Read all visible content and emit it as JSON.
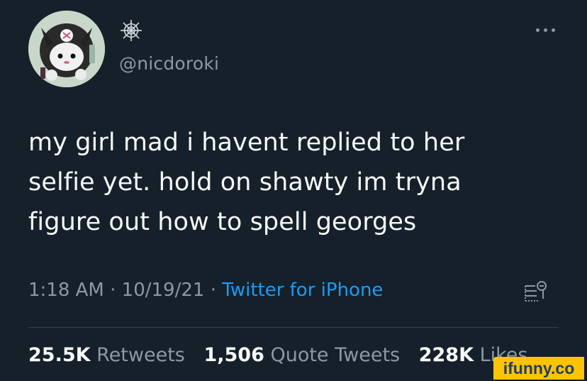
{
  "tweet": {
    "handle": "@nicdoroki",
    "text": "my girl mad i havent replied to her selfie yet. hold on shawty im tryna figure out how to spell georges",
    "time": "1:18 AM",
    "date": "10/19/21",
    "separator": "·",
    "source": "Twitter for iPhone",
    "stats": {
      "retweets_count": "25.5K",
      "retweets_label": "Retweets",
      "quotes_count": "1,506",
      "quotes_label": "Quote Tweets",
      "likes_count": "228K",
      "likes_label": "Likes"
    }
  },
  "icons": {
    "display_name": "spider-web-icon",
    "more": "more-options-icon",
    "analytics": "analytics-icon"
  },
  "watermark": "ifunny.co",
  "colors": {
    "background": "#15202b",
    "text": "#f7f9f9",
    "secondary_text": "#8b98a5",
    "link": "#1d9bf0",
    "divider": "#38444d",
    "watermark_bg": "#ffc400"
  }
}
